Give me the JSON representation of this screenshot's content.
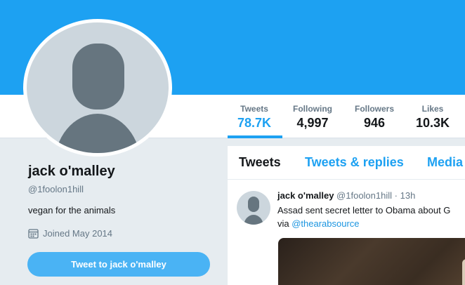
{
  "profile": {
    "name": "jack o'malley",
    "handle": "@1foolon1hill",
    "bio": "vegan for the animals",
    "joined": "Joined May 2014",
    "tweet_to_label": "Tweet to jack o'malley"
  },
  "stats": [
    {
      "label": "Tweets",
      "value": "78.7K"
    },
    {
      "label": "Following",
      "value": "4,997"
    },
    {
      "label": "Followers",
      "value": "946"
    },
    {
      "label": "Likes",
      "value": "10.3K"
    }
  ],
  "tabs": [
    {
      "label": "Tweets"
    },
    {
      "label": "Tweets & replies"
    },
    {
      "label": "Media"
    }
  ],
  "tweet": {
    "author": "jack o'malley",
    "handle": "@1foolon1hill",
    "separator": "·",
    "time": "13h",
    "text": "Assad sent secret letter to Obama about G",
    "via": "via ",
    "link": "@thearabsource"
  },
  "colors": {
    "accent": "#1da1f2",
    "button": "#4ab3f4",
    "link": "#1b95e0",
    "muted": "#657786",
    "background": "#e6ecf0"
  }
}
